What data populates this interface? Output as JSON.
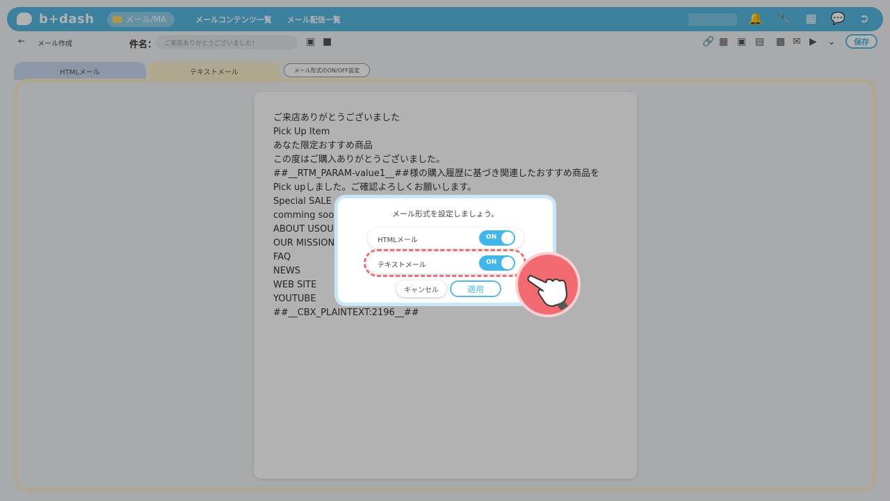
{
  "topbar": {
    "logo": "b+dash",
    "pill": "メール/MA",
    "nav": [
      "メールコンテンツ一覧",
      "メール配信一覧"
    ],
    "icons": [
      "bell-icon",
      "wrench-icon",
      "grid-icon",
      "chat-icon",
      "logout-icon"
    ]
  },
  "toolbar": {
    "crumb": "メール作成",
    "subject_label": "件名：",
    "subject_value": "ご来店ありがとうございました！",
    "save_label": "保存"
  },
  "tabs": {
    "html": "HTMLメール",
    "text": "テキストメール",
    "onoff": "メール形式のON/OFF設定"
  },
  "body_lines": [
    "ご来店ありがとうございました",
    "Pick Up Item",
    "あなた限定おすすめ商品",
    "この度はご購入ありがとうございました。",
    "##__RTM_PARAM-value1__##様の購入履歴に基づき関連したおすすめ商品を",
    "Pick upしました。ご確認よろしくお願いします。",
    "Special SALE",
    "comming soon",
    "ABOUT USOU",
    "OUR MISSION",
    "FAQ",
    "NEWS",
    "WEB SITE",
    "YOUTUBE",
    "##__CBX_PLAINTEXT:2196__##"
  ],
  "modal": {
    "title": "メール形式を設定しましょう。",
    "rows": [
      {
        "label": "HTMLメール",
        "state": "ON"
      },
      {
        "label": "テキストメール",
        "state": "ON"
      }
    ],
    "cancel": "キャンセル",
    "apply": "適用"
  },
  "colors": {
    "accent": "#55b9e3",
    "toggle": "#40b6ea",
    "highlight": "#e96f73",
    "tab_html": "#c9daf0",
    "tab_text": "#fbf0cc"
  }
}
